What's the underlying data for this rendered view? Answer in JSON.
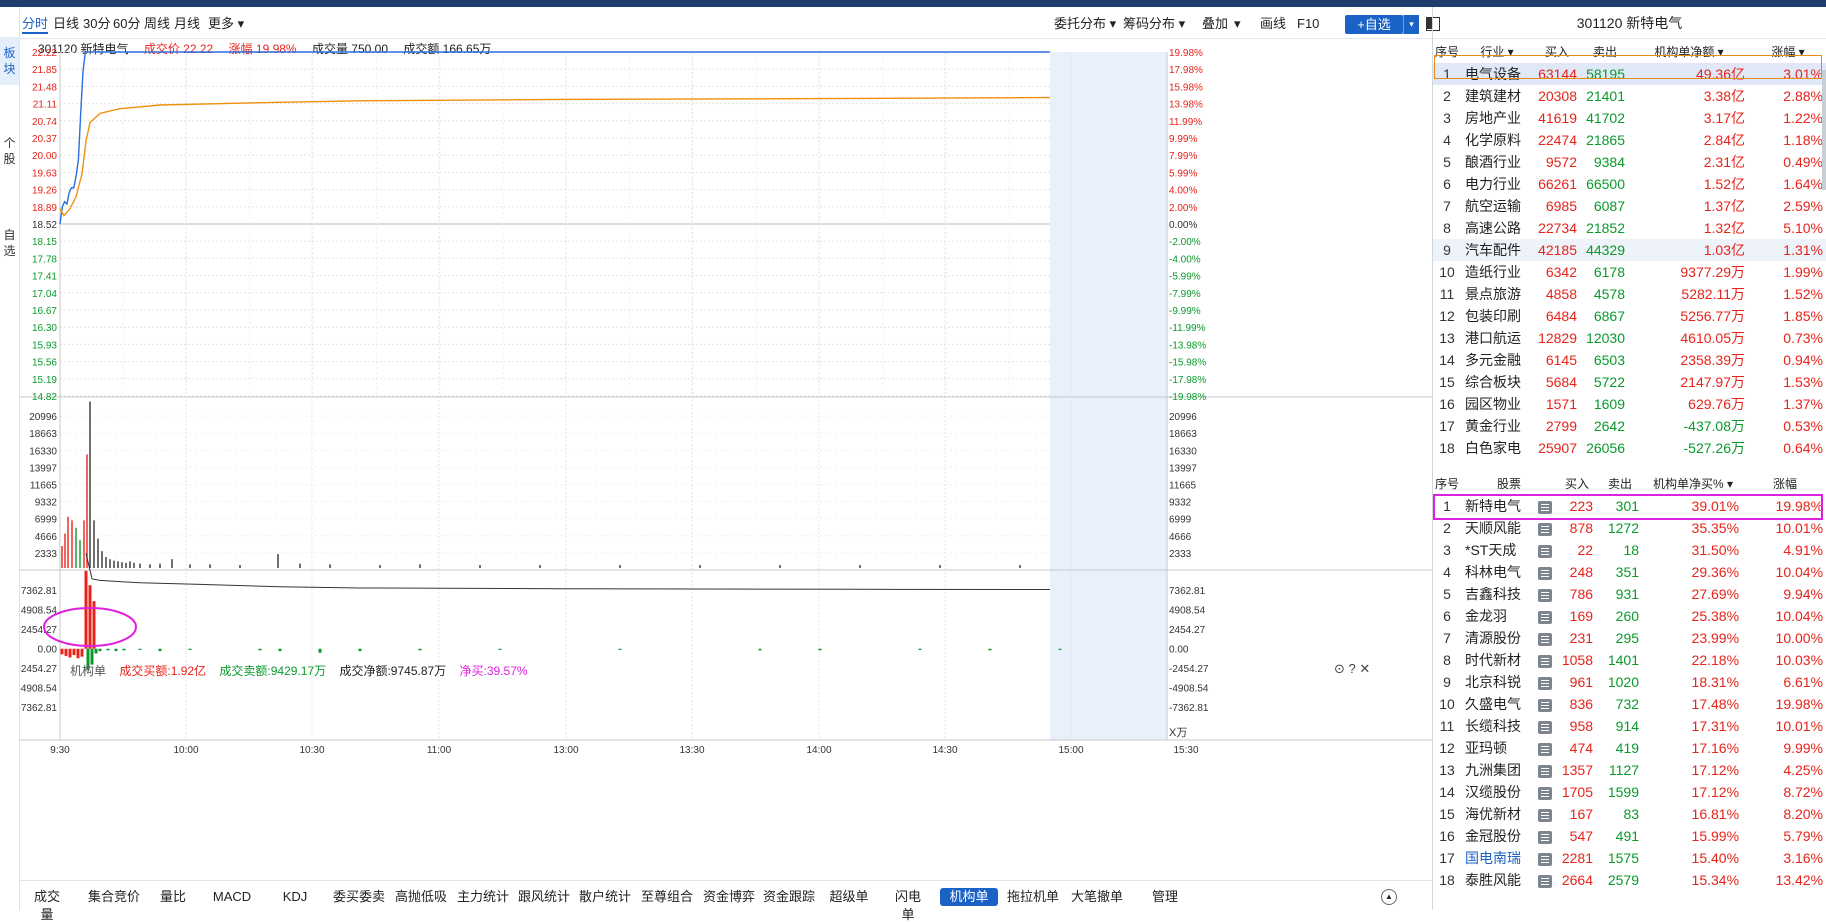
{
  "left_tabs": [
    "板块",
    "个股",
    "自选"
  ],
  "toolbar": {
    "periods": [
      "分时",
      "日线",
      "30分",
      "60分",
      "周线",
      "月线",
      "更多 ▾"
    ],
    "right_items": [
      "委托分布 ▾",
      "筹码分布 ▾",
      "叠加",
      "▾",
      "画线",
      "F10"
    ],
    "add_watch": "+自选",
    "add_watch_drop": "▾"
  },
  "stock": {
    "code_name": "301120 新特电气",
    "price_label": "成交价 22.22",
    "change_label": "涨幅 19.98%",
    "volume_label": "成交量 750.00",
    "amount_label": "成交额 166.65万"
  },
  "price_axis": {
    "left": [
      "22.22",
      "21.85",
      "21.48",
      "21.11",
      "20.74",
      "20.37",
      "20.00",
      "19.63",
      "19.26",
      "18.89",
      "18.52",
      "18.15",
      "17.78",
      "17.41",
      "17.04",
      "16.67",
      "16.30",
      "15.93",
      "15.56",
      "15.19",
      "14.82"
    ],
    "right": [
      "19.98%",
      "17.98%",
      "15.98%",
      "13.98%",
      "11.99%",
      "9.99%",
      "7.99%",
      "5.99%",
      "4.00%",
      "2.00%",
      "0.00%",
      "-2.00%",
      "-4.00%",
      "-5.99%",
      "-7.99%",
      "-9.99%",
      "-11.99%",
      "-13.98%",
      "-15.98%",
      "-17.98%",
      "-19.98%"
    ]
  },
  "volume_axis": [
    "20996",
    "18663",
    "16330",
    "13997",
    "11665",
    "9332",
    "6999",
    "4666",
    "2333"
  ],
  "institution": {
    "label": "机构单",
    "buy": "成交买额:1.92亿",
    "sell": "成交卖额:9429.17万",
    "net": "成交净额:9745.87万",
    "net_buy": "净买:39.57%",
    "axis": [
      "7362.81",
      "4908.54",
      "2454.27",
      "0.00",
      "-2454.27",
      "-4908.54",
      "-7362.81"
    ],
    "unit": "X万"
  },
  "time_axis": [
    "9:30",
    "10:00",
    "10:30",
    "11:00",
    "13:00",
    "13:30",
    "14:00",
    "14:30",
    "15:00",
    "15:30"
  ],
  "bottom_tabs": [
    "成交量",
    "集合竞价",
    "量比",
    "MACD",
    "KDJ",
    "委买委卖",
    "高抛低吸",
    "主力统计",
    "跟风统计",
    "散户统计",
    "至尊组合",
    "资金博弈",
    "资金跟踪",
    "超级单",
    "闪电单",
    "机构单",
    "拖拉机单",
    "大笔撤单",
    "管理"
  ],
  "bottom_selected": "机构单",
  "colors": {
    "up": "#e8231a",
    "down": "#0a9a2c",
    "accent": "#1a62c6",
    "highlight": "#e020e0"
  },
  "right_panel": {
    "title": "301120 新特电气",
    "industry_headers": [
      "序号",
      "行业 ▾",
      "买入",
      "卖出",
      "机构单净额 ▾",
      "涨幅 ▾"
    ],
    "industries": [
      {
        "n": "1",
        "name": "电气设备",
        "buy": "63144",
        "sell": "58195",
        "net": "49.36亿",
        "chg": "3.01%"
      },
      {
        "n": "2",
        "name": "建筑建材",
        "buy": "20308",
        "sell": "21401",
        "net": "3.38亿",
        "chg": "2.88%"
      },
      {
        "n": "3",
        "name": "房地产业",
        "buy": "41619",
        "sell": "41702",
        "net": "3.17亿",
        "chg": "1.22%"
      },
      {
        "n": "4",
        "name": "化学原料",
        "buy": "22474",
        "sell": "21865",
        "net": "2.84亿",
        "chg": "1.18%"
      },
      {
        "n": "5",
        "name": "酿酒行业",
        "buy": "9572",
        "sell": "9384",
        "net": "2.31亿",
        "chg": "0.49%"
      },
      {
        "n": "6",
        "name": "电力行业",
        "buy": "66261",
        "sell": "66500",
        "net": "1.52亿",
        "chg": "1.64%"
      },
      {
        "n": "7",
        "name": "航空运输",
        "buy": "6985",
        "sell": "6087",
        "net": "1.37亿",
        "chg": "2.59%"
      },
      {
        "n": "8",
        "name": "高速公路",
        "buy": "22734",
        "sell": "21852",
        "net": "1.32亿",
        "chg": "5.10%"
      },
      {
        "n": "9",
        "name": "汽车配件",
        "buy": "42185",
        "sell": "44329",
        "net": "1.03亿",
        "chg": "1.31%"
      },
      {
        "n": "10",
        "name": "造纸行业",
        "buy": "6342",
        "sell": "6178",
        "net": "9377.29万",
        "chg": "1.99%"
      },
      {
        "n": "11",
        "name": "景点旅游",
        "buy": "4858",
        "sell": "4578",
        "net": "5282.11万",
        "chg": "1.52%"
      },
      {
        "n": "12",
        "name": "包装印刷",
        "buy": "6484",
        "sell": "6867",
        "net": "5256.77万",
        "chg": "1.85%"
      },
      {
        "n": "13",
        "name": "港口航运",
        "buy": "12829",
        "sell": "12030",
        "net": "4610.05万",
        "chg": "0.73%"
      },
      {
        "n": "14",
        "name": "多元金融",
        "buy": "6145",
        "sell": "6503",
        "net": "2358.39万",
        "chg": "0.94%"
      },
      {
        "n": "15",
        "name": "综合板块",
        "buy": "5684",
        "sell": "5722",
        "net": "2147.97万",
        "chg": "1.53%"
      },
      {
        "n": "16",
        "name": "园区物业",
        "buy": "1571",
        "sell": "1609",
        "net": "629.76万",
        "chg": "1.37%"
      },
      {
        "n": "17",
        "name": "黄金行业",
        "buy": "2799",
        "sell": "2642",
        "net": "-437.08万",
        "chg": "0.53%"
      },
      {
        "n": "18",
        "name": "白色家电",
        "buy": "25907",
        "sell": "26056",
        "net": "-527.26万",
        "chg": "0.64%"
      }
    ],
    "stock_headers": [
      "序号",
      "股票",
      "买入",
      "卖出",
      "机构单净买% ▾",
      "涨幅"
    ],
    "stocks": [
      {
        "n": "1",
        "name": "新特电气",
        "buy": "223",
        "sell": "301",
        "pct": "39.01%",
        "chg": "19.98%"
      },
      {
        "n": "2",
        "name": "天顺风能",
        "buy": "878",
        "sell": "1272",
        "pct": "35.35%",
        "chg": "10.01%"
      },
      {
        "n": "3",
        "name": "*ST天成",
        "buy": "22",
        "sell": "18",
        "pct": "31.50%",
        "chg": "4.91%"
      },
      {
        "n": "4",
        "name": "科林电气",
        "buy": "248",
        "sell": "351",
        "pct": "29.36%",
        "chg": "10.04%"
      },
      {
        "n": "5",
        "name": "吉鑫科技",
        "buy": "786",
        "sell": "931",
        "pct": "27.69%",
        "chg": "9.94%"
      },
      {
        "n": "6",
        "name": "金龙羽",
        "buy": "169",
        "sell": "260",
        "pct": "25.38%",
        "chg": "10.04%"
      },
      {
        "n": "7",
        "name": "清源股份",
        "buy": "231",
        "sell": "295",
        "pct": "23.99%",
        "chg": "10.00%"
      },
      {
        "n": "8",
        "name": "时代新材",
        "buy": "1058",
        "sell": "1401",
        "pct": "22.18%",
        "chg": "10.03%"
      },
      {
        "n": "9",
        "name": "北京科锐",
        "buy": "961",
        "sell": "1020",
        "pct": "18.31%",
        "chg": "6.61%"
      },
      {
        "n": "10",
        "name": "久盛电气",
        "buy": "836",
        "sell": "732",
        "pct": "17.48%",
        "chg": "19.98%"
      },
      {
        "n": "11",
        "name": "长缆科技",
        "buy": "958",
        "sell": "914",
        "pct": "17.31%",
        "chg": "10.01%"
      },
      {
        "n": "12",
        "name": "亚玛顿",
        "buy": "474",
        "sell": "419",
        "pct": "17.16%",
        "chg": "9.99%"
      },
      {
        "n": "13",
        "name": "九洲集团",
        "buy": "1357",
        "sell": "1127",
        "pct": "17.12%",
        "chg": "4.25%"
      },
      {
        "n": "14",
        "name": "汉缆股份",
        "buy": "1705",
        "sell": "1599",
        "pct": "17.12%",
        "chg": "8.72%"
      },
      {
        "n": "15",
        "name": "海优新材",
        "buy": "167",
        "sell": "83",
        "pct": "16.81%",
        "chg": "8.20%"
      },
      {
        "n": "16",
        "name": "金冠股份",
        "buy": "547",
        "sell": "491",
        "pct": "15.99%",
        "chg": "5.79%"
      },
      {
        "n": "17",
        "name": "国电南瑞",
        "buy": "2281",
        "sell": "1575",
        "pct": "15.40%",
        "chg": "3.16%"
      },
      {
        "n": "18",
        "name": "泰胜风能",
        "buy": "2664",
        "sell": "2579",
        "pct": "15.34%",
        "chg": "13.42%"
      }
    ]
  }
}
